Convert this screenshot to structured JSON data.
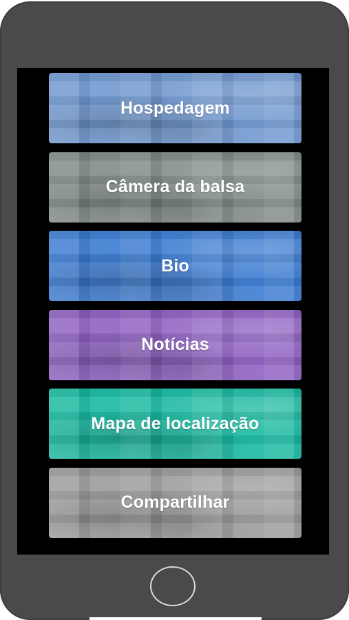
{
  "menu": {
    "items": [
      {
        "label": "Hospedagem",
        "color": "#6f97cf"
      },
      {
        "label": "Câmera da balsa",
        "color": "#7f8a85"
      },
      {
        "label": "Bio",
        "color": "#3a7ad0"
      },
      {
        "label": "Notícias",
        "color": "#8d5fc0"
      },
      {
        "label": "Mapa de localização",
        "color": "#17b8a0"
      },
      {
        "label": "Compartilhar",
        "color": "#9a9a9a"
      }
    ]
  },
  "device": {
    "body_color": "#4a4a4a",
    "screen_color": "#000000",
    "home_button": "home-button-icon"
  }
}
